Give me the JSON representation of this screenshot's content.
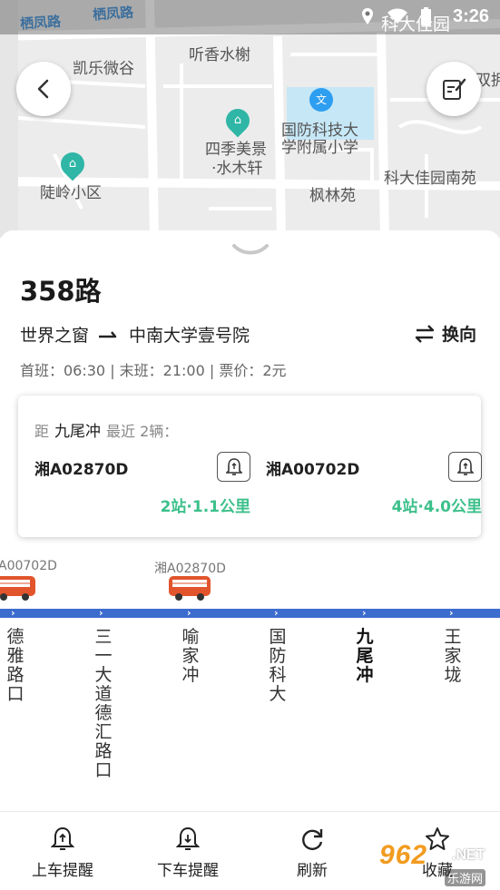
{
  "status_bar": {
    "time": "3:26"
  },
  "map": {
    "labels": {
      "street_1": "栖凤路",
      "street_2": "栖凤路",
      "top_right": "科大佳园",
      "kaile": "凯乐微谷",
      "tingxiang": "听香水榭",
      "siji_1": "四季美景",
      "siji_2": "·水木轩",
      "school_1": "国防科技大",
      "school_2": "学附属小学",
      "keda_south": "科大佳园南苑",
      "linglin": "陡岭小区",
      "fenglin": "枫林苑",
      "edge_right": "双拥"
    },
    "school_poi_glyph": "文"
  },
  "route": {
    "name": "358路",
    "from": "世界之窗",
    "to": "中南大学壹号院",
    "swap_label": "换向",
    "times": "首班：06:30 | 末班：21:00 | 票价：2元"
  },
  "nearby": {
    "prefix": "距",
    "station": "九尾冲",
    "suffix": "最近 2辆：",
    "buses": [
      {
        "plate": "湘A02870D",
        "distance": "2站·1.1公里"
      },
      {
        "plate": "湘A00702D",
        "distance": "4站·4.0公里"
      }
    ]
  },
  "line": {
    "bus_tags": [
      "A00702D",
      "湘A02870D"
    ],
    "stops": [
      "德雅路口",
      "三一大道德汇路口",
      "喻家冲",
      "国防科大",
      "九尾冲",
      "王家垅"
    ],
    "current_stop_index": 4,
    "accent_color": "#3d6ccf"
  },
  "bottom_bar": {
    "tabs": [
      "上车提醒",
      "下车提醒",
      "刷新",
      "收藏"
    ]
  },
  "watermark": {
    "big": "962",
    "net": ".NET",
    "small": "乐游网"
  },
  "colors": {
    "green": "#3cc08a",
    "blue_line": "#3d6ccf",
    "bus": "#e2542c"
  }
}
